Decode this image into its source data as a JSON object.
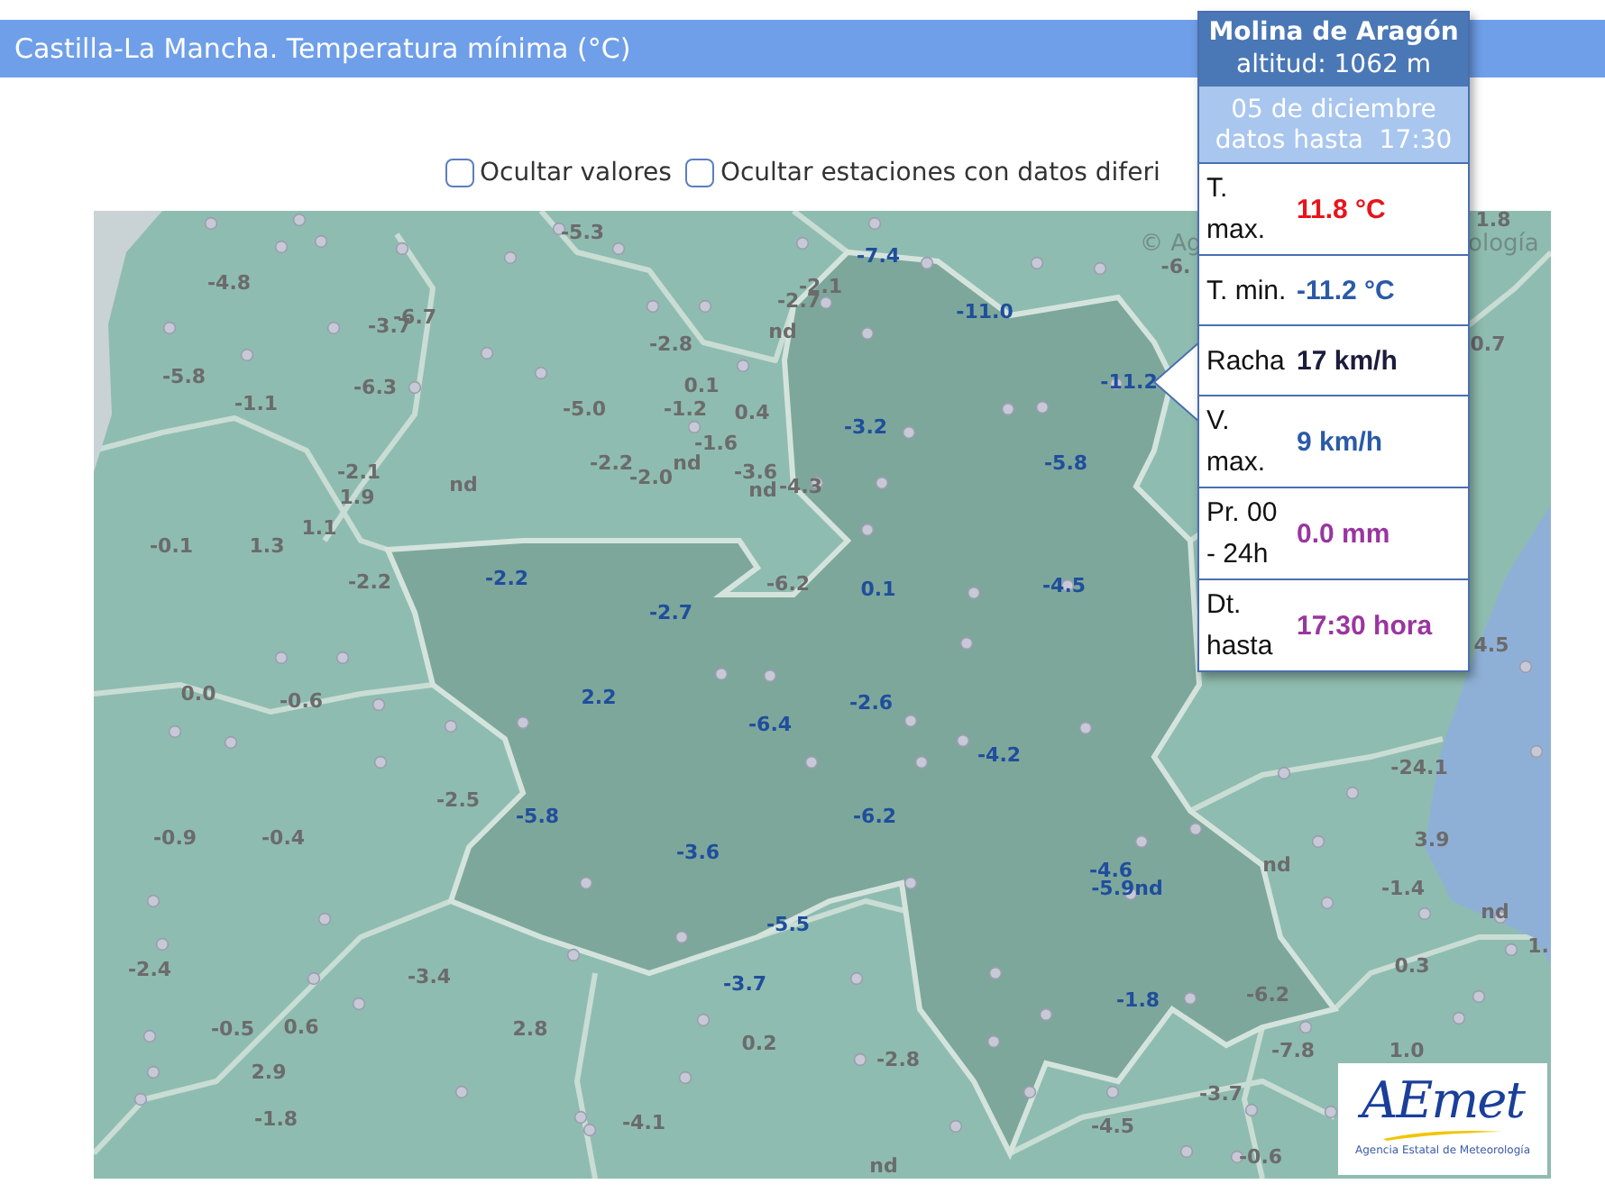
{
  "header": {
    "title": "Castilla-La Mancha. Temperatura mínima (°C)"
  },
  "options": [
    {
      "label": "Ocultar valores",
      "checked": false
    },
    {
      "label": "Ocultar estaciones con datos diferi",
      "checked": false
    }
  ],
  "map": {
    "attribution": [
      "© Ag",
      "ología"
    ],
    "labels": [
      {
        "text": "-5.3",
        "color": "#6b6b6b"
      },
      {
        "text": "-7.4",
        "color": "#1f4e9c"
      },
      {
        "text": "-6.",
        "color": "#6b6b6b"
      },
      {
        "text": "1.8",
        "color": "#6b6b6b"
      },
      {
        "text": "-4.8",
        "color": "#6b6b6b"
      },
      {
        "text": "-2.7",
        "color": "#6b6b6b"
      },
      {
        "text": "-2.1",
        "color": "#6b6b6b"
      },
      {
        "text": "-6.7",
        "color": "#6b6b6b"
      },
      {
        "text": "-3.7",
        "color": "#6b6b6b"
      },
      {
        "text": "-11.0",
        "color": "#1f4e9c"
      },
      {
        "text": "nd",
        "color": "#6b6b6b"
      },
      {
        "text": "-2.8",
        "color": "#6b6b6b"
      },
      {
        "text": "0.7",
        "color": "#6b6b6b"
      },
      {
        "text": "-5.8",
        "color": "#6b6b6b"
      },
      {
        "text": "-1.1",
        "color": "#6b6b6b"
      },
      {
        "text": "-6.3",
        "color": "#6b6b6b"
      },
      {
        "text": "0.1",
        "color": "#6b6b6b"
      },
      {
        "text": "-11.2",
        "color": "#1f4e9c"
      },
      {
        "text": "-5.0",
        "color": "#6b6b6b"
      },
      {
        "text": "-1.2",
        "color": "#6b6b6b"
      },
      {
        "text": "0.4",
        "color": "#6b6b6b"
      },
      {
        "text": "-3.2",
        "color": "#1f4e9c"
      },
      {
        "text": "-1.6",
        "color": "#6b6b6b"
      },
      {
        "text": "-2.2",
        "color": "#6b6b6b"
      },
      {
        "text": "nd",
        "color": "#6b6b6b"
      },
      {
        "text": "-5.8",
        "color": "#1f4e9c"
      },
      {
        "text": "-2.1",
        "color": "#6b6b6b"
      },
      {
        "text": "-2.0",
        "color": "#6b6b6b"
      },
      {
        "text": "-3.6",
        "color": "#6b6b6b"
      },
      {
        "text": "nd",
        "color": "#6b6b6b"
      },
      {
        "text": "nd",
        "color": "#6b6b6b"
      },
      {
        "text": "-4.3",
        "color": "#6b6b6b"
      },
      {
        "text": "1.9",
        "color": "#6b6b6b"
      },
      {
        "text": "1.1",
        "color": "#6b6b6b"
      },
      {
        "text": "-0.1",
        "color": "#6b6b6b"
      },
      {
        "text": "1.3",
        "color": "#6b6b6b"
      },
      {
        "text": "-2.2",
        "color": "#6b6b6b"
      },
      {
        "text": "-2.2",
        "color": "#1f4e9c"
      },
      {
        "text": "-6.2",
        "color": "#6b6b6b"
      },
      {
        "text": "0.1",
        "color": "#1f4e9c"
      },
      {
        "text": "-4.5",
        "color": "#1f4e9c"
      },
      {
        "text": "-2.7",
        "color": "#1f4e9c"
      },
      {
        "text": "4.5",
        "color": "#6b6b6b"
      },
      {
        "text": "0.0",
        "color": "#6b6b6b"
      },
      {
        "text": "-0.6",
        "color": "#6b6b6b"
      },
      {
        "text": "2.2",
        "color": "#1f4e9c"
      },
      {
        "text": "-2.6",
        "color": "#1f4e9c"
      },
      {
        "text": "-6.4",
        "color": "#1f4e9c"
      },
      {
        "text": "-4.2",
        "color": "#1f4e9c"
      },
      {
        "text": "-24.1",
        "color": "#6b6b6b"
      },
      {
        "text": "-2.5",
        "color": "#6b6b6b"
      },
      {
        "text": "-5.8",
        "color": "#1f4e9c"
      },
      {
        "text": "-6.2",
        "color": "#1f4e9c"
      },
      {
        "text": "-0.9",
        "color": "#6b6b6b"
      },
      {
        "text": "-0.4",
        "color": "#6b6b6b"
      },
      {
        "text": "3.9",
        "color": "#6b6b6b"
      },
      {
        "text": "-3.6",
        "color": "#1f4e9c"
      },
      {
        "text": "nd",
        "color": "#6b6b6b"
      },
      {
        "text": "-4.6",
        "color": "#1f4e9c"
      },
      {
        "text": "-5.9nd",
        "color": "#1f4e9c"
      },
      {
        "text": "-1.4",
        "color": "#6b6b6b"
      },
      {
        "text": "nd",
        "color": "#6b6b6b"
      },
      {
        "text": "-5.5",
        "color": "#1f4e9c"
      },
      {
        "text": "1.",
        "color": "#6b6b6b"
      },
      {
        "text": "0.3",
        "color": "#6b6b6b"
      },
      {
        "text": "-2.4",
        "color": "#6b6b6b"
      },
      {
        "text": "-3.4",
        "color": "#6b6b6b"
      },
      {
        "text": "-3.7",
        "color": "#1f4e9c"
      },
      {
        "text": "-6.2",
        "color": "#6b6b6b"
      },
      {
        "text": "-1.8",
        "color": "#1f4e9c"
      },
      {
        "text": "-0.5",
        "color": "#6b6b6b"
      },
      {
        "text": "0.6",
        "color": "#6b6b6b"
      },
      {
        "text": "2.8",
        "color": "#6b6b6b"
      },
      {
        "text": "0.2",
        "color": "#6b6b6b"
      },
      {
        "text": "-7.8",
        "color": "#6b6b6b"
      },
      {
        "text": "1.0",
        "color": "#6b6b6b"
      },
      {
        "text": "-2.8",
        "color": "#6b6b6b"
      },
      {
        "text": "2.9",
        "color": "#6b6b6b"
      },
      {
        "text": "-3.7",
        "color": "#6b6b6b"
      },
      {
        "text": "-1.8",
        "color": "#6b6b6b"
      },
      {
        "text": "-4.1",
        "color": "#6b6b6b"
      },
      {
        "text": "-4.5",
        "color": "#6b6b6b"
      },
      {
        "text": "-0.6",
        "color": "#6b6b6b"
      },
      {
        "text": "nd",
        "color": "#6b6b6b"
      }
    ]
  },
  "popup": {
    "station": "Molina de Aragón",
    "altitude": "altitud: 1062 m",
    "date": "05 de diciembre",
    "data_until": "datos hasta  17:30",
    "rows": [
      {
        "label": "T. max.",
        "value": "11.8 °C",
        "color": "#e8141a"
      },
      {
        "label": "T. min.",
        "value": "-11.2 °C",
        "color": "#2a5aa8"
      },
      {
        "label": "Racha",
        "value": "17 km/h",
        "color": "#1c1c3c"
      },
      {
        "label": "V. max.",
        "value": "9 km/h",
        "color": "#2a5aa8"
      },
      {
        "label": "Pr. 00 - 24h",
        "value": "0.0 mm",
        "color": "#9a35a0"
      },
      {
        "label": "Dt. hasta",
        "value": "17:30 hora",
        "color": "#9a35a0"
      }
    ]
  },
  "logo": {
    "mark": "AEmet",
    "name": "Agencia Estatal de Meteorología"
  }
}
